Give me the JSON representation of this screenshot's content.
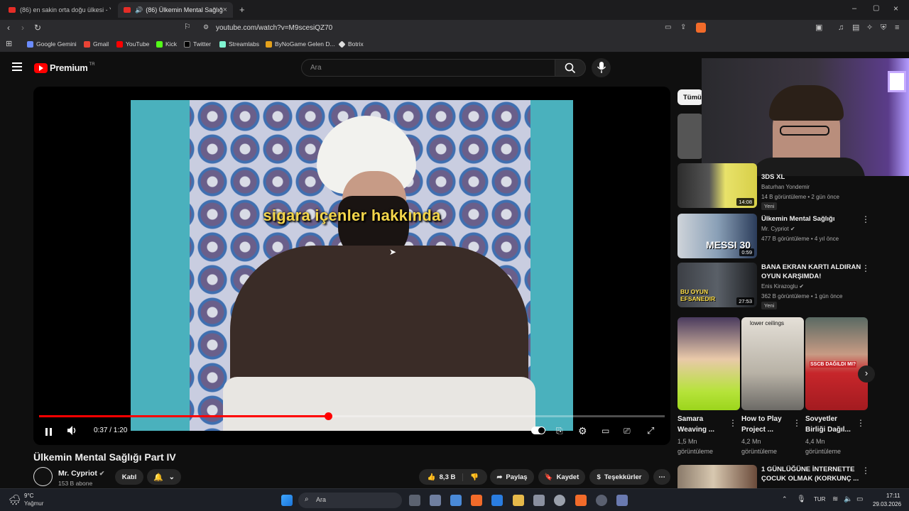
{
  "browser": {
    "tabs": [
      {
        "title": "(86) en sakin orta doğu ülkesi - YouT",
        "active": false
      },
      {
        "title": "(86) Ülkemin Mental Sağlığı P",
        "active": true
      }
    ],
    "url": "youtube.com/watch?v=M9scesiQZ70",
    "bookmarks": [
      "Google Gemini",
      "Gmail",
      "YouTube",
      "Kick",
      "Twitter",
      "Streamlabs",
      "ByNoGame Gelen D...",
      "Botrix"
    ]
  },
  "youtube": {
    "logo": "Premium",
    "logo_region": "TR",
    "search_placeholder": "Ara",
    "chip": "Tümü"
  },
  "player": {
    "subtitle": "sigara içenler hakkında",
    "current_time": "0:37",
    "duration": "1:20",
    "time_display": "0:37 / 1:20",
    "progress": 0.4625
  },
  "video": {
    "title": "Ülkemin Mental Sağlığı Part IV",
    "channel": "Mr. Cypriot",
    "subscribers": "153 B abone",
    "join_label": "Katıl",
    "likes": "8,3 B",
    "share_label": "Paylaş",
    "save_label": "Kaydet",
    "thanks_label": "Teşekkürler"
  },
  "sidebar": {
    "items": [
      {
        "title": "3DS XL",
        "channel": "Baturhan Yondemir",
        "meta": "14 B görüntüleme • 2 gün önce",
        "badge": "Yeni",
        "duration": "14:08"
      },
      {
        "title": "Ülkemin Mental Sağlığı",
        "channel": "Mr. Cypriot",
        "meta": "477 B görüntüleme • 4 yıl önce",
        "duration": "0:59",
        "thumb_text": "MESSI 30"
      },
      {
        "title_line1": "BANA EKRAN KARTI ALDIRAN",
        "title_line2": "OYUN KARŞIMDA!",
        "channel": "Enis Kirazoglu",
        "meta": "362 B görüntüleme • 1 gün önce",
        "badge": "Yeni",
        "duration": "27:53",
        "thumb_text": "BU OYUN EFSANEDIR"
      }
    ],
    "shorts": [
      {
        "title_line1": "Samara",
        "title_line2": "Weaving ...",
        "views_line1": "1,5 Mn",
        "views_line2": "görüntüleme"
      },
      {
        "title_line1": "How to Play",
        "title_line2": "Project ...",
        "views_line1": "4,2 Mn",
        "views_line2": "görüntüleme",
        "thumb_text": "lower ceilings"
      },
      {
        "title_line1": "Sovyetler",
        "title_line2": "Birliği Dağıl...",
        "views_line1": "4,4 Mn",
        "views_line2": "görüntüleme",
        "thumb_text": "SSCB DAĞILDI MI?"
      }
    ],
    "bottom_item": {
      "title_line1": "1 GÜNLÜĞÜNE İNTERNETTE",
      "title_line2": "ÇOCUK OLMAK (KORKUNÇ ..."
    }
  },
  "taskbar": {
    "weather_temp": "9°C",
    "weather_desc": "Yağmur",
    "search_placeholder": "Ara",
    "lang": "TUR",
    "time": "17:11",
    "date": "29.03.2026"
  }
}
